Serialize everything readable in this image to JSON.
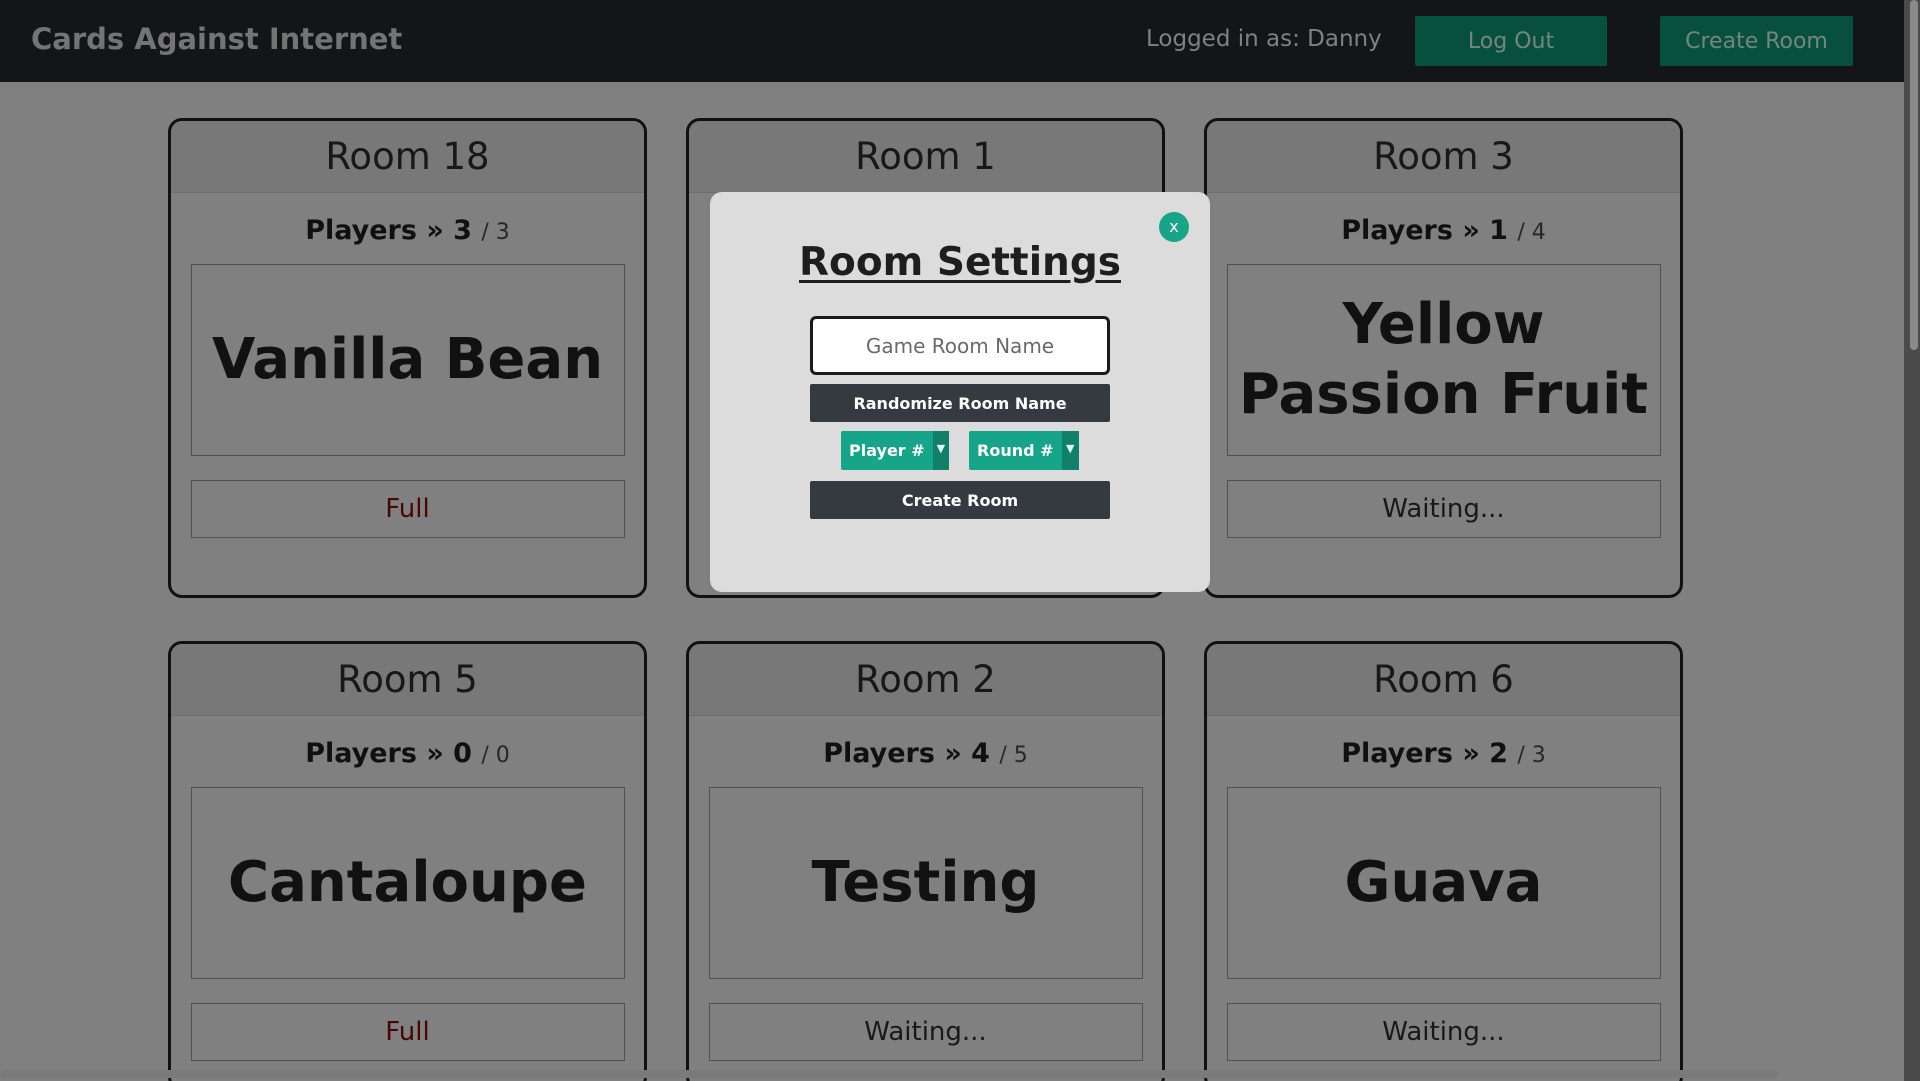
{
  "navbar": {
    "brand": "Cards Against Internet",
    "logged_in_text": "Logged in as: Danny",
    "logout_label": "Log Out",
    "create_room_label": "Create Room"
  },
  "rooms": [
    {
      "title": "Room 18",
      "players_label": "Players » 3",
      "players_max": "/ 3",
      "name": "Vanilla Bean",
      "status": "Full"
    },
    {
      "title": "Room 1",
      "players_label": "",
      "players_max": "",
      "name": "",
      "status": ""
    },
    {
      "title": "Room 3",
      "players_label": "Players » 1",
      "players_max": "/ 4",
      "name": "Yellow Passion Fruit",
      "status": "Waiting..."
    },
    {
      "title": "Room 5",
      "players_label": "Players » 0",
      "players_max": "/ 0",
      "name": "Cantaloupe",
      "status": "Full"
    },
    {
      "title": "Room 2",
      "players_label": "Players » 4",
      "players_max": "/ 5",
      "name": "Testing",
      "status": "Waiting..."
    },
    {
      "title": "Room 6",
      "players_label": "Players » 2",
      "players_max": "/ 3",
      "name": "Guava",
      "status": "Waiting..."
    }
  ],
  "modal": {
    "close_label": "x",
    "title": "Room Settings",
    "input_placeholder": "Game Room Name",
    "input_value": "",
    "randomize_label": "Randomize Room Name",
    "player_select_label": "Player #",
    "round_select_label": "Round #",
    "dropdown_arrow": "▼",
    "create_label": "Create Room"
  },
  "colors": {
    "navbar_bg": "#212529",
    "accent_green": "#0f8a6b",
    "teal": "#17a589",
    "dark_button": "#343a40",
    "full_status": "#7a0a0a"
  },
  "icons": {
    "close": "close-icon",
    "dropdown": "chevron-down-icon"
  }
}
